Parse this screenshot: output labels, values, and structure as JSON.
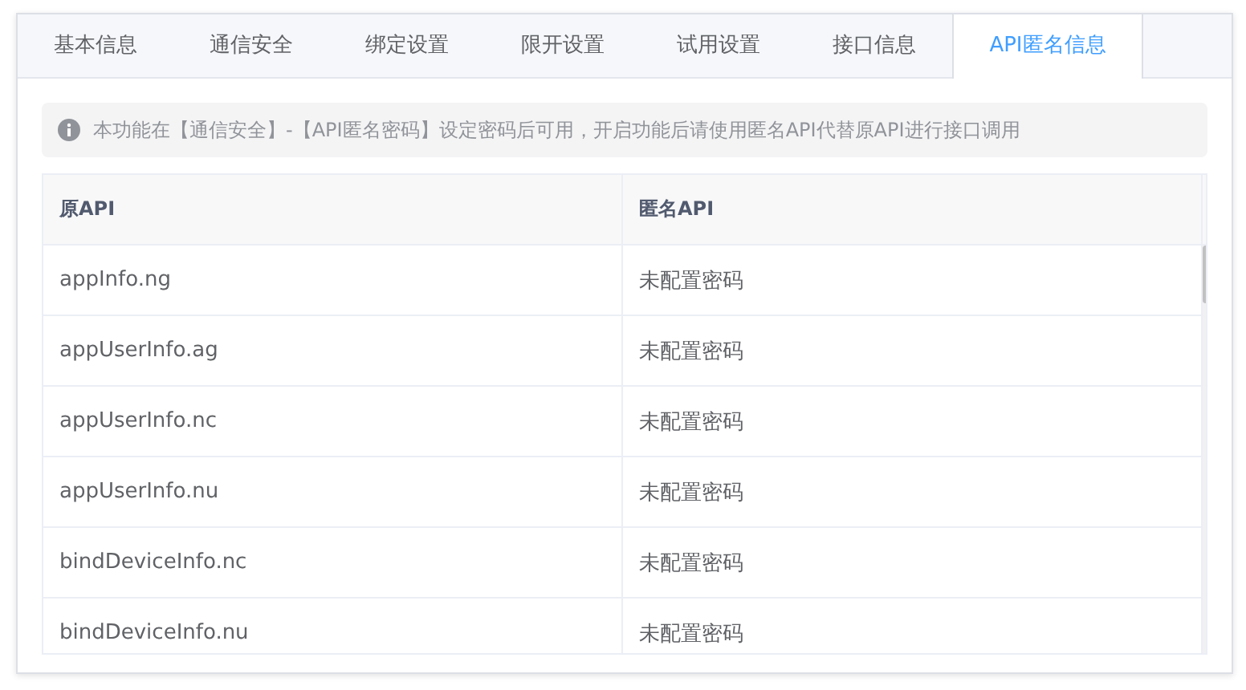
{
  "tabs": [
    {
      "label": "基本信息",
      "selected": false
    },
    {
      "label": "通信安全",
      "selected": false
    },
    {
      "label": "绑定设置",
      "selected": false
    },
    {
      "label": "限开设置",
      "selected": false
    },
    {
      "label": "试用设置",
      "selected": false
    },
    {
      "label": "接口信息",
      "selected": false
    },
    {
      "label": "API匿名信息",
      "selected": true
    }
  ],
  "notice": {
    "text": "本功能在【通信安全】-【API匿名密码】设定密码后可用，开启功能后请使用匿名API代替原API进行接口调用"
  },
  "table": {
    "columns": [
      "原API",
      "匿名API"
    ],
    "rows": [
      [
        "appInfo.ng",
        "未配置密码"
      ],
      [
        "appUserInfo.ag",
        "未配置密码"
      ],
      [
        "appUserInfo.nc",
        "未配置密码"
      ],
      [
        "appUserInfo.nu",
        "未配置密码"
      ],
      [
        "bindDeviceInfo.nc",
        "未配置密码"
      ],
      [
        "bindDeviceInfo.nu",
        "未配置密码"
      ]
    ]
  }
}
